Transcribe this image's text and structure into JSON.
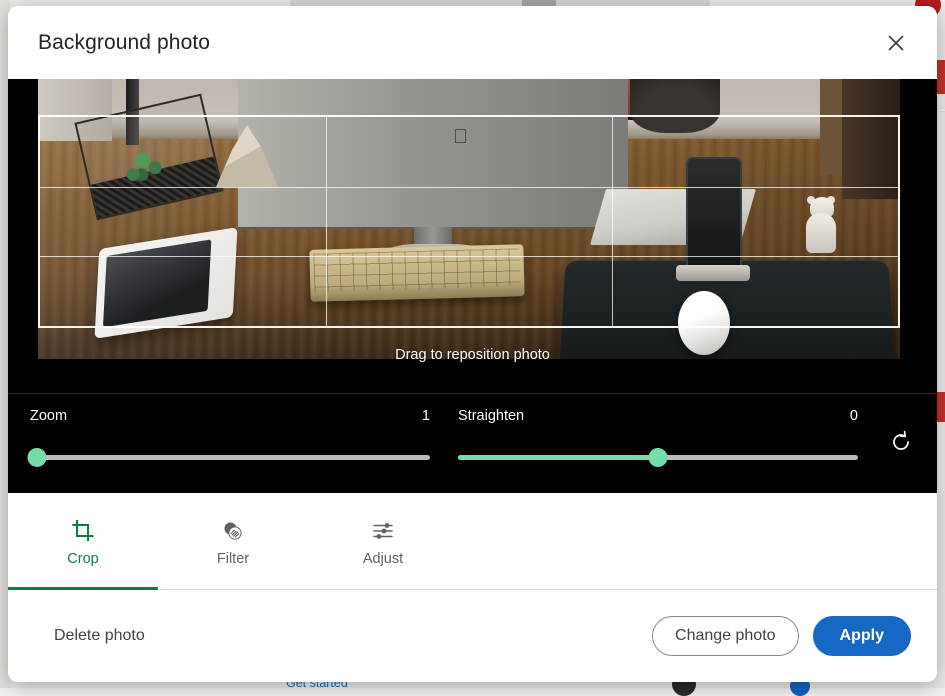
{
  "dialog": {
    "title": "Background photo",
    "close_icon": "close-icon",
    "reposition_hint": "Drag to reposition photo"
  },
  "photo": {
    "alt": "Wooden desk with iMac, keyboard, mouse on mousepad, tablet, terrarium with succulent, origami sculpture, phone on dock and small white bear figurine",
    "crop_grid": "rule-of-thirds"
  },
  "sliders": [
    {
      "name": "zoom",
      "label": "Zoom",
      "value": "1",
      "fill_percent": 0
    },
    {
      "name": "straighten",
      "label": "Straighten",
      "value": "0",
      "fill_percent": 50
    }
  ],
  "reset": {
    "icon": "rotate-reset-icon",
    "tooltip": "Reset"
  },
  "tabs": [
    {
      "id": "crop",
      "label": "Crop",
      "icon": "crop-icon",
      "active": true
    },
    {
      "id": "filter",
      "label": "Filter",
      "icon": "filter-icon",
      "active": false
    },
    {
      "id": "adjust",
      "label": "Adjust",
      "icon": "adjust-icon",
      "active": false
    }
  ],
  "footer": {
    "delete_label": "Delete photo",
    "change_label": "Change photo",
    "apply_label": "Apply"
  },
  "colors": {
    "accent_green": "#107c41",
    "slider_green": "#75dda8",
    "primary_blue": "#1668c4",
    "panel_black": "#000000",
    "dialog_white": "#ffffff"
  },
  "background_page": {
    "get_started": "Get started"
  }
}
